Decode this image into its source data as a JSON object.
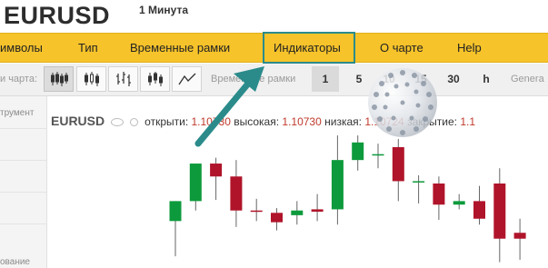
{
  "header": {
    "symbol": "EURUSD",
    "timeframe": "1 Минута"
  },
  "menu": {
    "items": [
      {
        "label": "имволы"
      },
      {
        "label": "Тип"
      },
      {
        "label": "Временные рамки"
      },
      {
        "label": "Индикаторы"
      },
      {
        "label": "О чарте"
      },
      {
        "label": "Help"
      }
    ],
    "highlighted": "Индикаторы"
  },
  "toolbar": {
    "chart_type_label": "и чарта:",
    "chart_types": [
      {
        "icon": "candlestick-icon",
        "active": true
      },
      {
        "icon": "hollow-candle-icon",
        "active": false
      },
      {
        "icon": "ohlc-bars-icon",
        "active": false
      },
      {
        "icon": "hlc-bars-icon",
        "active": false
      },
      {
        "icon": "line-chart-icon",
        "active": false
      }
    ],
    "timeframe_label": "Временные рамки",
    "timeframes": [
      {
        "label": "1",
        "active": true
      },
      {
        "label": "5",
        "active": false
      },
      {
        "label": "10",
        "active": false
      },
      {
        "label": "15",
        "active": false
      },
      {
        "label": "30",
        "active": false
      },
      {
        "label": "h",
        "active": false
      }
    ],
    "general_label": "Genera"
  },
  "left_panel": {
    "label_top": "трумент",
    "label_bottom": "ование"
  },
  "quote": {
    "symbol": "EURUSD",
    "open_label": "открыти",
    "open": "1.10730",
    "high_label": "высокая:",
    "high": "1.10730",
    "low_label": "низкая:",
    "low": "1.10724",
    "close_label": "закрытие:",
    "close": "1.1"
  },
  "colors": {
    "up": "#0d9a3c",
    "down": "#b0142a",
    "menu_bg": "#f6c32a",
    "highlight": "#2b8b8b",
    "price_text": "#c0392b"
  },
  "chart_data": {
    "type": "candlestick",
    "candles": [
      {
        "o": 1.10695,
        "h": 1.10712,
        "l": 1.10665,
        "c": 1.10712
      },
      {
        "o": 1.10712,
        "h": 1.10744,
        "l": 1.10704,
        "c": 1.10744
      },
      {
        "o": 1.10744,
        "h": 1.10749,
        "l": 1.10713,
        "c": 1.10733
      },
      {
        "o": 1.10733,
        "h": 1.10747,
        "l": 1.1069,
        "c": 1.10704
      },
      {
        "o": 1.10704,
        "h": 1.10714,
        "l": 1.10695,
        "c": 1.10703
      },
      {
        "o": 1.10702,
        "h": 1.10706,
        "l": 1.10687,
        "c": 1.10694
      },
      {
        "o": 1.107,
        "h": 1.10712,
        "l": 1.10692,
        "c": 1.10704
      },
      {
        "o": 1.10705,
        "h": 1.10718,
        "l": 1.10695,
        "c": 1.10703
      },
      {
        "o": 1.10705,
        "h": 1.10768,
        "l": 1.10692,
        "c": 1.10747
      },
      {
        "o": 1.10747,
        "h": 1.10768,
        "l": 1.10738,
        "c": 1.10762
      },
      {
        "o": 1.10752,
        "h": 1.10761,
        "l": 1.1074,
        "c": 1.10752
      },
      {
        "o": 1.10758,
        "h": 1.10765,
        "l": 1.10712,
        "c": 1.10729
      },
      {
        "o": 1.10729,
        "h": 1.10734,
        "l": 1.1071,
        "c": 1.10729
      },
      {
        "o": 1.10727,
        "h": 1.10733,
        "l": 1.10696,
        "c": 1.10709
      },
      {
        "o": 1.10709,
        "h": 1.10718,
        "l": 1.10705,
        "c": 1.10712
      },
      {
        "o": 1.10712,
        "h": 1.10725,
        "l": 1.10692,
        "c": 1.10697
      },
      {
        "o": 1.10727,
        "h": 1.1074,
        "l": 1.1066,
        "c": 1.1068
      },
      {
        "o": 1.10685,
        "h": 1.10697,
        "l": 1.10662,
        "c": 1.1068
      }
    ]
  }
}
